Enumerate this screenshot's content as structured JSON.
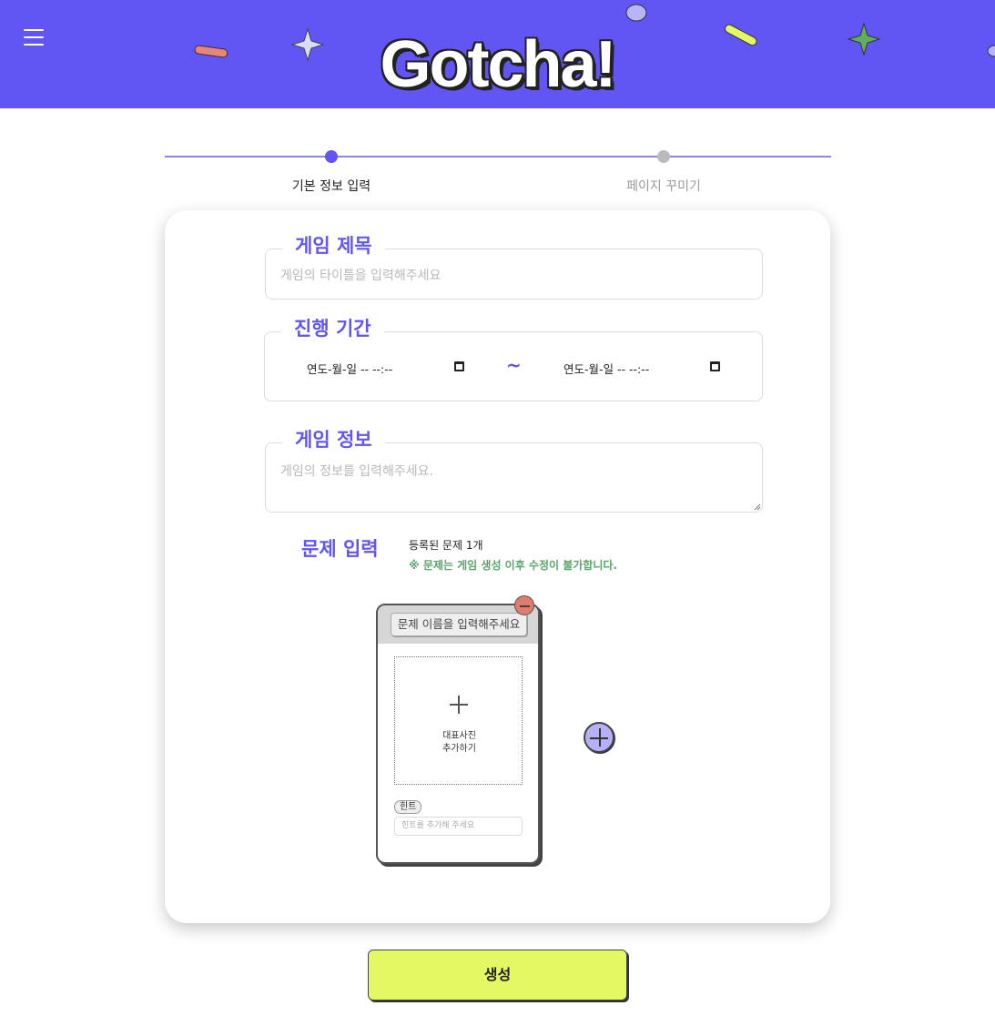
{
  "header": {
    "logo": "Gotcha!",
    "colors": {
      "background": "#6156f4",
      "accent": "#e4f864"
    }
  },
  "stepper": {
    "steps": [
      {
        "label": "기본 정보 입력",
        "active": true
      },
      {
        "label": "페이지 꾸미기",
        "active": false
      }
    ]
  },
  "form": {
    "title": {
      "legend": "게임 제목",
      "placeholder": "게임의 타이틀을 입력해주세요"
    },
    "period": {
      "legend": "진행 기간",
      "start": "연도-월-일 -- --:--",
      "separator": "~",
      "end": "연도-월-일 -- --:--"
    },
    "info": {
      "legend": "게임 정보",
      "placeholder": "게임의 정보를 입력해주세요."
    },
    "questions": {
      "title": "문제 입력",
      "registered": "등록된 문제 1개",
      "warning": "※ 문제는 게임 생성 이후 수정이 불가합니다.",
      "card": {
        "name_placeholder": "문제 이름을 입력해주세요",
        "photo_label_1": "대표사진",
        "photo_label_2": "추가하기",
        "hint_label": "힌트",
        "hint_placeholder": "힌트를 추가해 주세요"
      }
    }
  },
  "submit": {
    "label": "생성"
  }
}
